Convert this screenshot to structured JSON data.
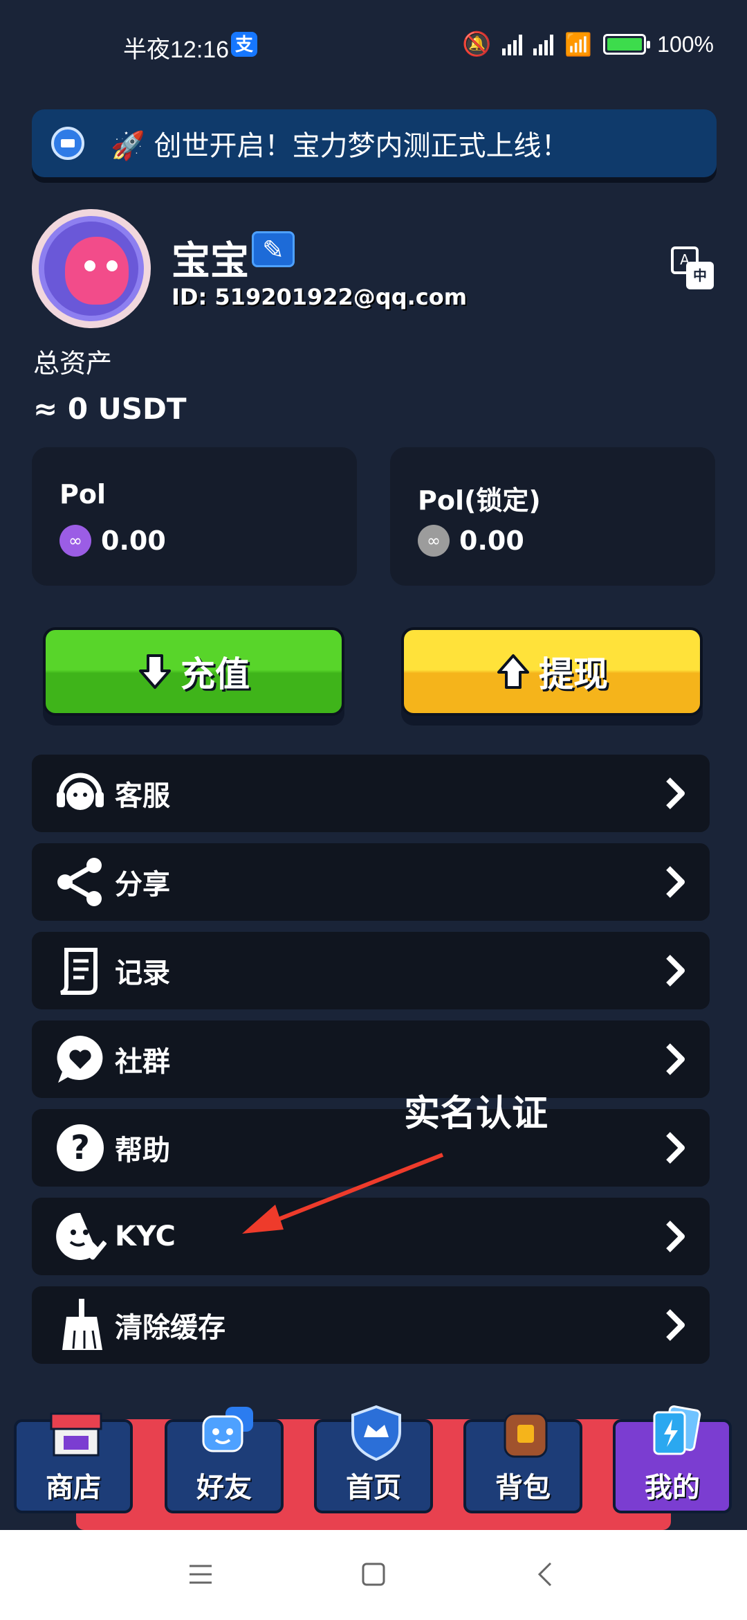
{
  "status_bar": {
    "time": "半夜12:16",
    "alipay_badge": "支",
    "battery_pct": "100%"
  },
  "banner": {
    "text": "🚀 创世开启！宝力梦内测正式上线！"
  },
  "profile": {
    "username": "宝宝",
    "id": "ID: 519201922@qq.com",
    "translate_a": "A",
    "translate_b": "中"
  },
  "assets": {
    "label": "总资产",
    "value": "≈ 0 USDT"
  },
  "cards": [
    {
      "title": "Pol",
      "amount": "0.00"
    },
    {
      "title": "Pol(锁定)",
      "amount": "0.00"
    }
  ],
  "actions": {
    "deposit": "充值",
    "withdraw": "提现"
  },
  "menu": [
    {
      "label": "客服",
      "icon": "headset-icon"
    },
    {
      "label": "分享",
      "icon": "share-icon"
    },
    {
      "label": "记录",
      "icon": "receipt-icon"
    },
    {
      "label": "社群",
      "icon": "heart-chat-icon"
    },
    {
      "label": "帮助",
      "icon": "help-icon"
    },
    {
      "label": "KYC",
      "icon": "face-check-icon"
    },
    {
      "label": "清除缓存",
      "icon": "broom-icon"
    }
  ],
  "annotation": {
    "text": "实名认证"
  },
  "bottom_nav": [
    {
      "label": "商店",
      "icon": "shop-icon"
    },
    {
      "label": "好友",
      "icon": "friends-icon"
    },
    {
      "label": "首页",
      "icon": "home-shield-icon"
    },
    {
      "label": "背包",
      "icon": "backpack-icon"
    },
    {
      "label": "我的",
      "icon": "cards-icon"
    }
  ],
  "colors": {
    "background": "#1a2438",
    "deposit": "#4cc520",
    "withdraw": "#f9c72a",
    "active_tab": "#7b3dd1"
  }
}
